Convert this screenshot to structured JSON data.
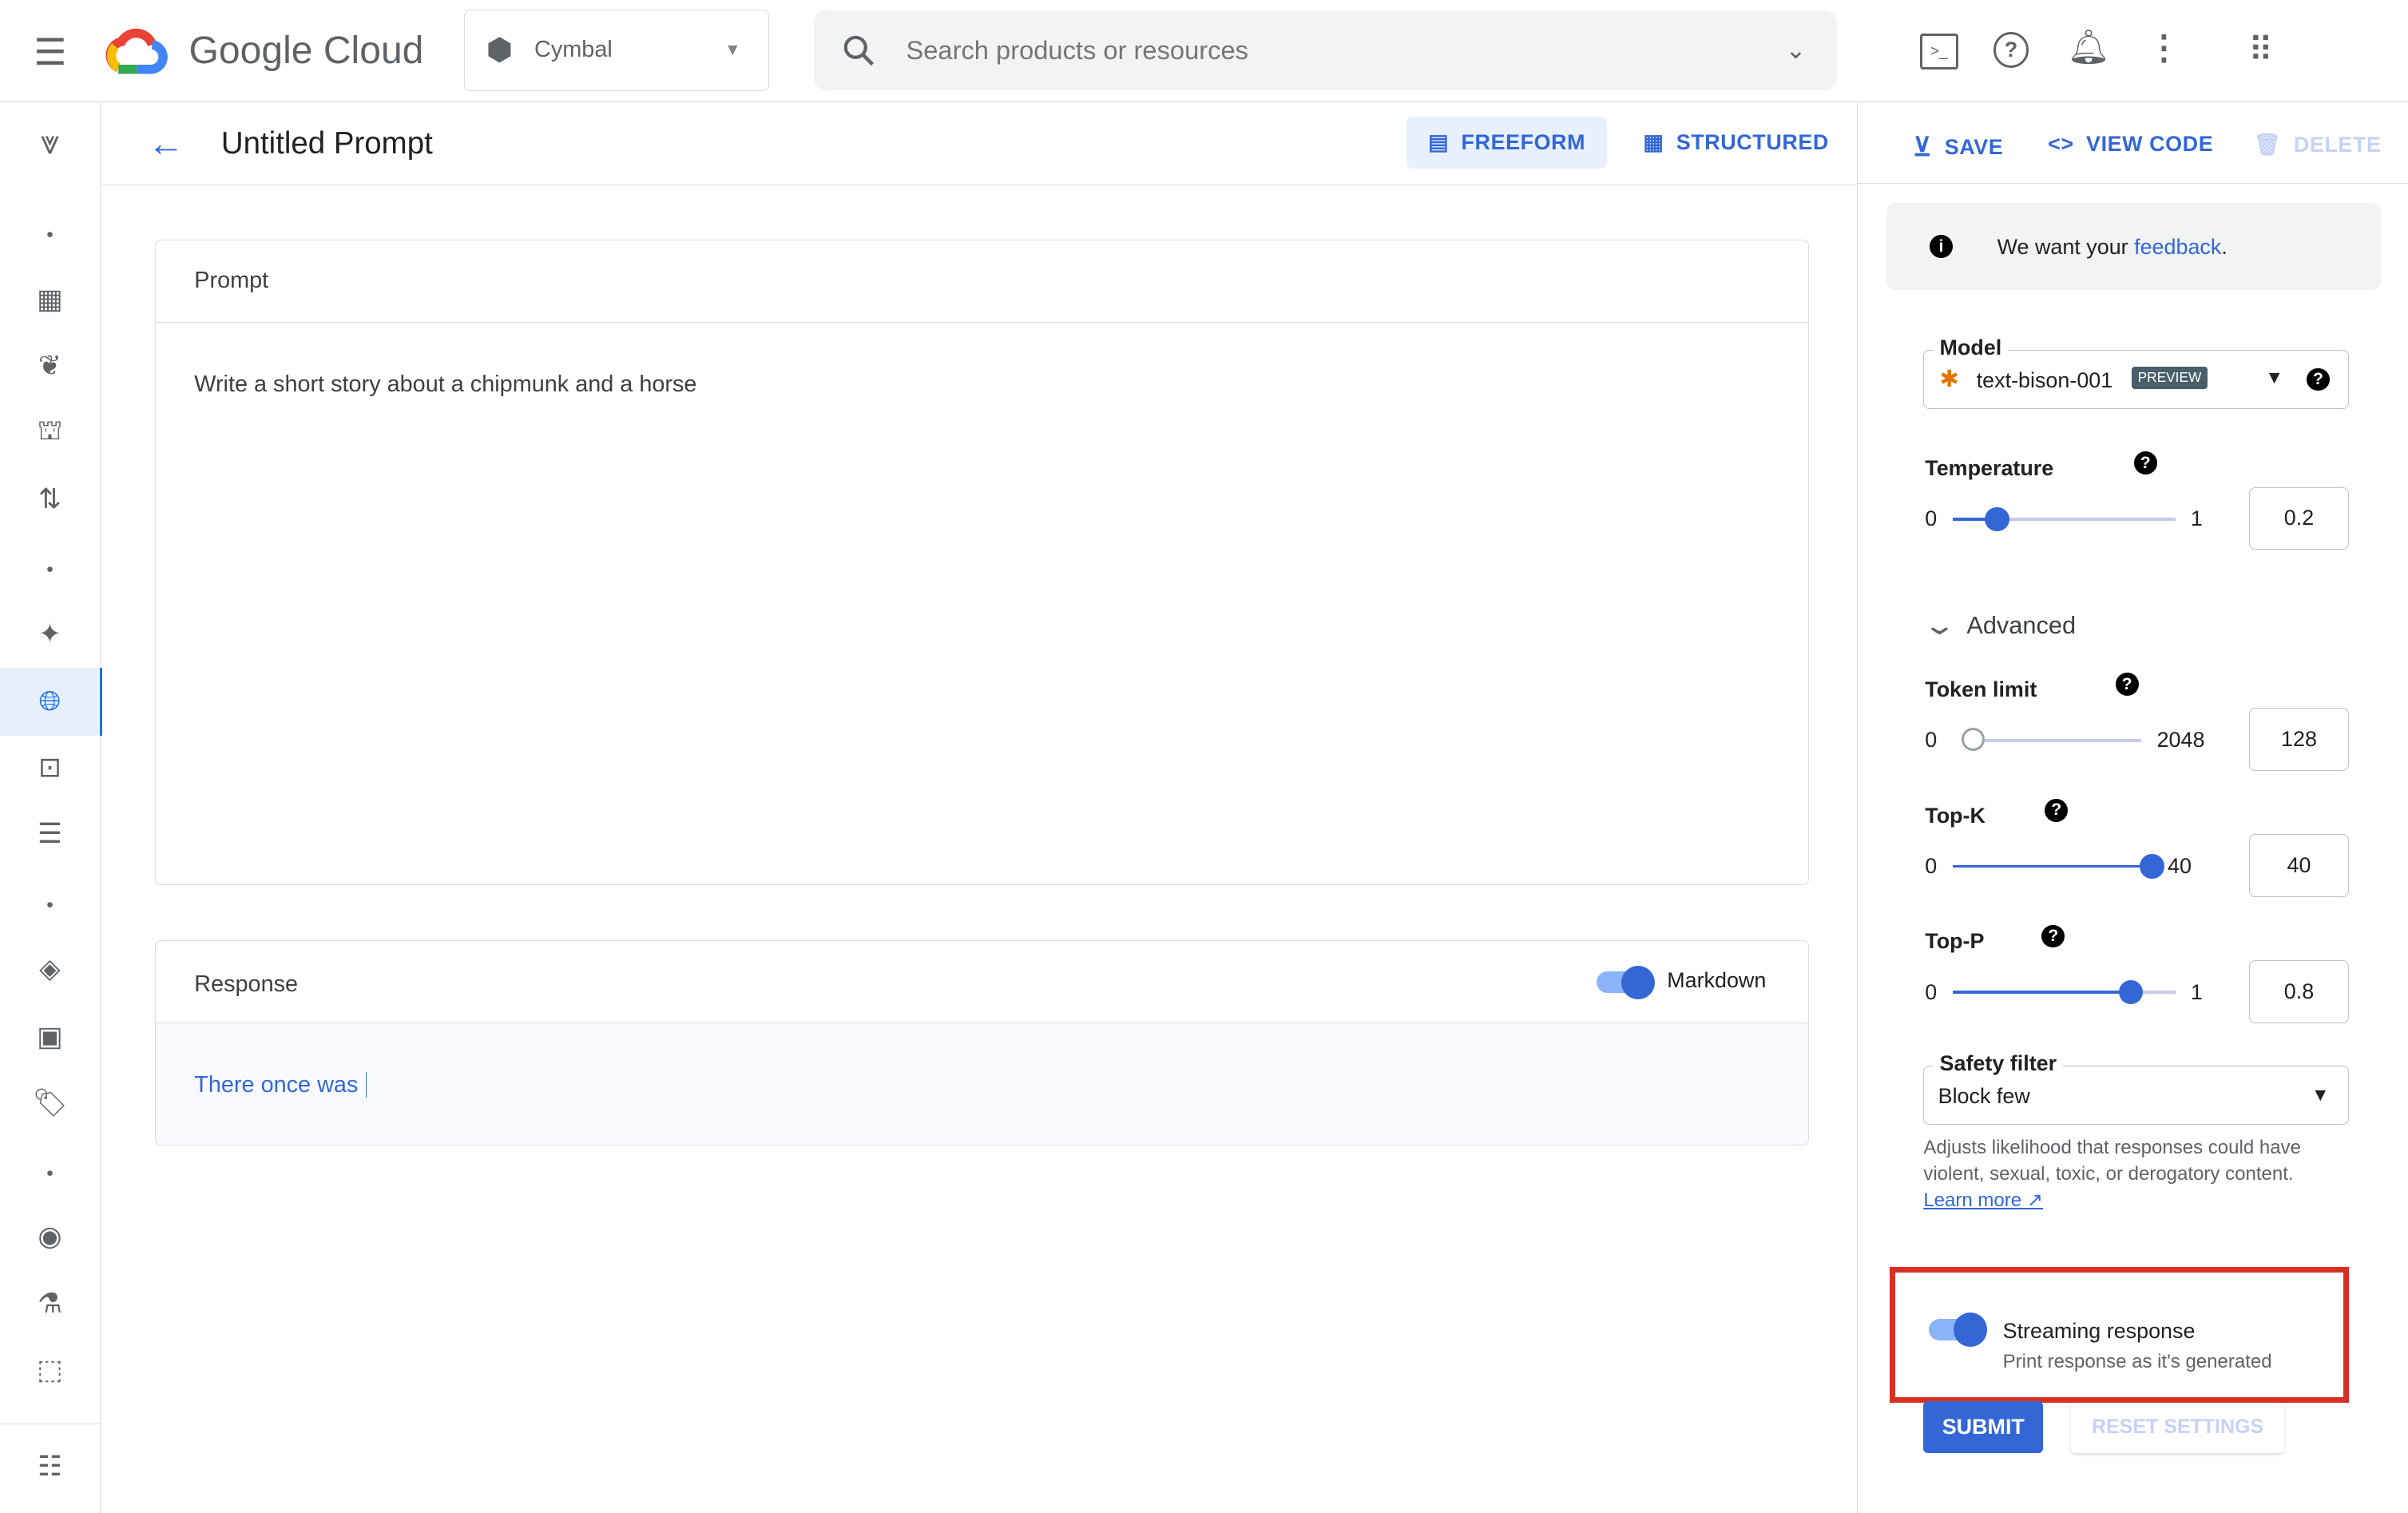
{
  "topbar": {
    "brand": "Google Cloud",
    "project": "Cymbal",
    "search_placeholder": "Search products or resources"
  },
  "header": {
    "title": "Untitled Prompt",
    "tabs": [
      {
        "label": "FREEFORM",
        "active": true
      },
      {
        "label": "STRUCTURED",
        "active": false
      }
    ],
    "save": "SAVE",
    "view_code": "VIEW CODE",
    "delete": "DELETE"
  },
  "prompt": {
    "title": "Prompt",
    "text": "Write a short story about a chipmunk and a horse"
  },
  "response": {
    "title": "Response",
    "markdown_label": "Markdown",
    "markdown_on": true,
    "text": "There once was"
  },
  "settings": {
    "feedback_prefix": "We want your ",
    "feedback_link": "feedback",
    "feedback_suffix": ".",
    "model_label": "Model",
    "model_value": "text-bison-001",
    "model_badge": "PREVIEW",
    "temperature": {
      "label": "Temperature",
      "min": "0",
      "max": "1",
      "value": "0.2",
      "fraction": 0.2
    },
    "advanced_label": "Advanced",
    "token_limit": {
      "label": "Token limit",
      "min": "0",
      "max": "2048",
      "value": "128",
      "fraction": 0.0
    },
    "top_k": {
      "label": "Top-K",
      "min": "0",
      "max": "40",
      "value": "40",
      "fraction": 1.0
    },
    "top_p": {
      "label": "Top-P",
      "min": "0",
      "max": "1",
      "value": "0.8",
      "fraction": 0.8
    },
    "safety_label": "Safety filter",
    "safety_value": "Block few",
    "safety_help": "Adjusts likelihood that responses could have violent, sexual, toxic, or derogatory content.",
    "learn_more": "Learn more",
    "streaming_title": "Streaming response",
    "streaming_sub": "Print response as it's generated",
    "streaming_on": true,
    "submit": "SUBMIT",
    "reset": "RESET SETTINGS"
  },
  "colors": {
    "accent": "#3367d6",
    "highlight_box": "#d93025"
  }
}
